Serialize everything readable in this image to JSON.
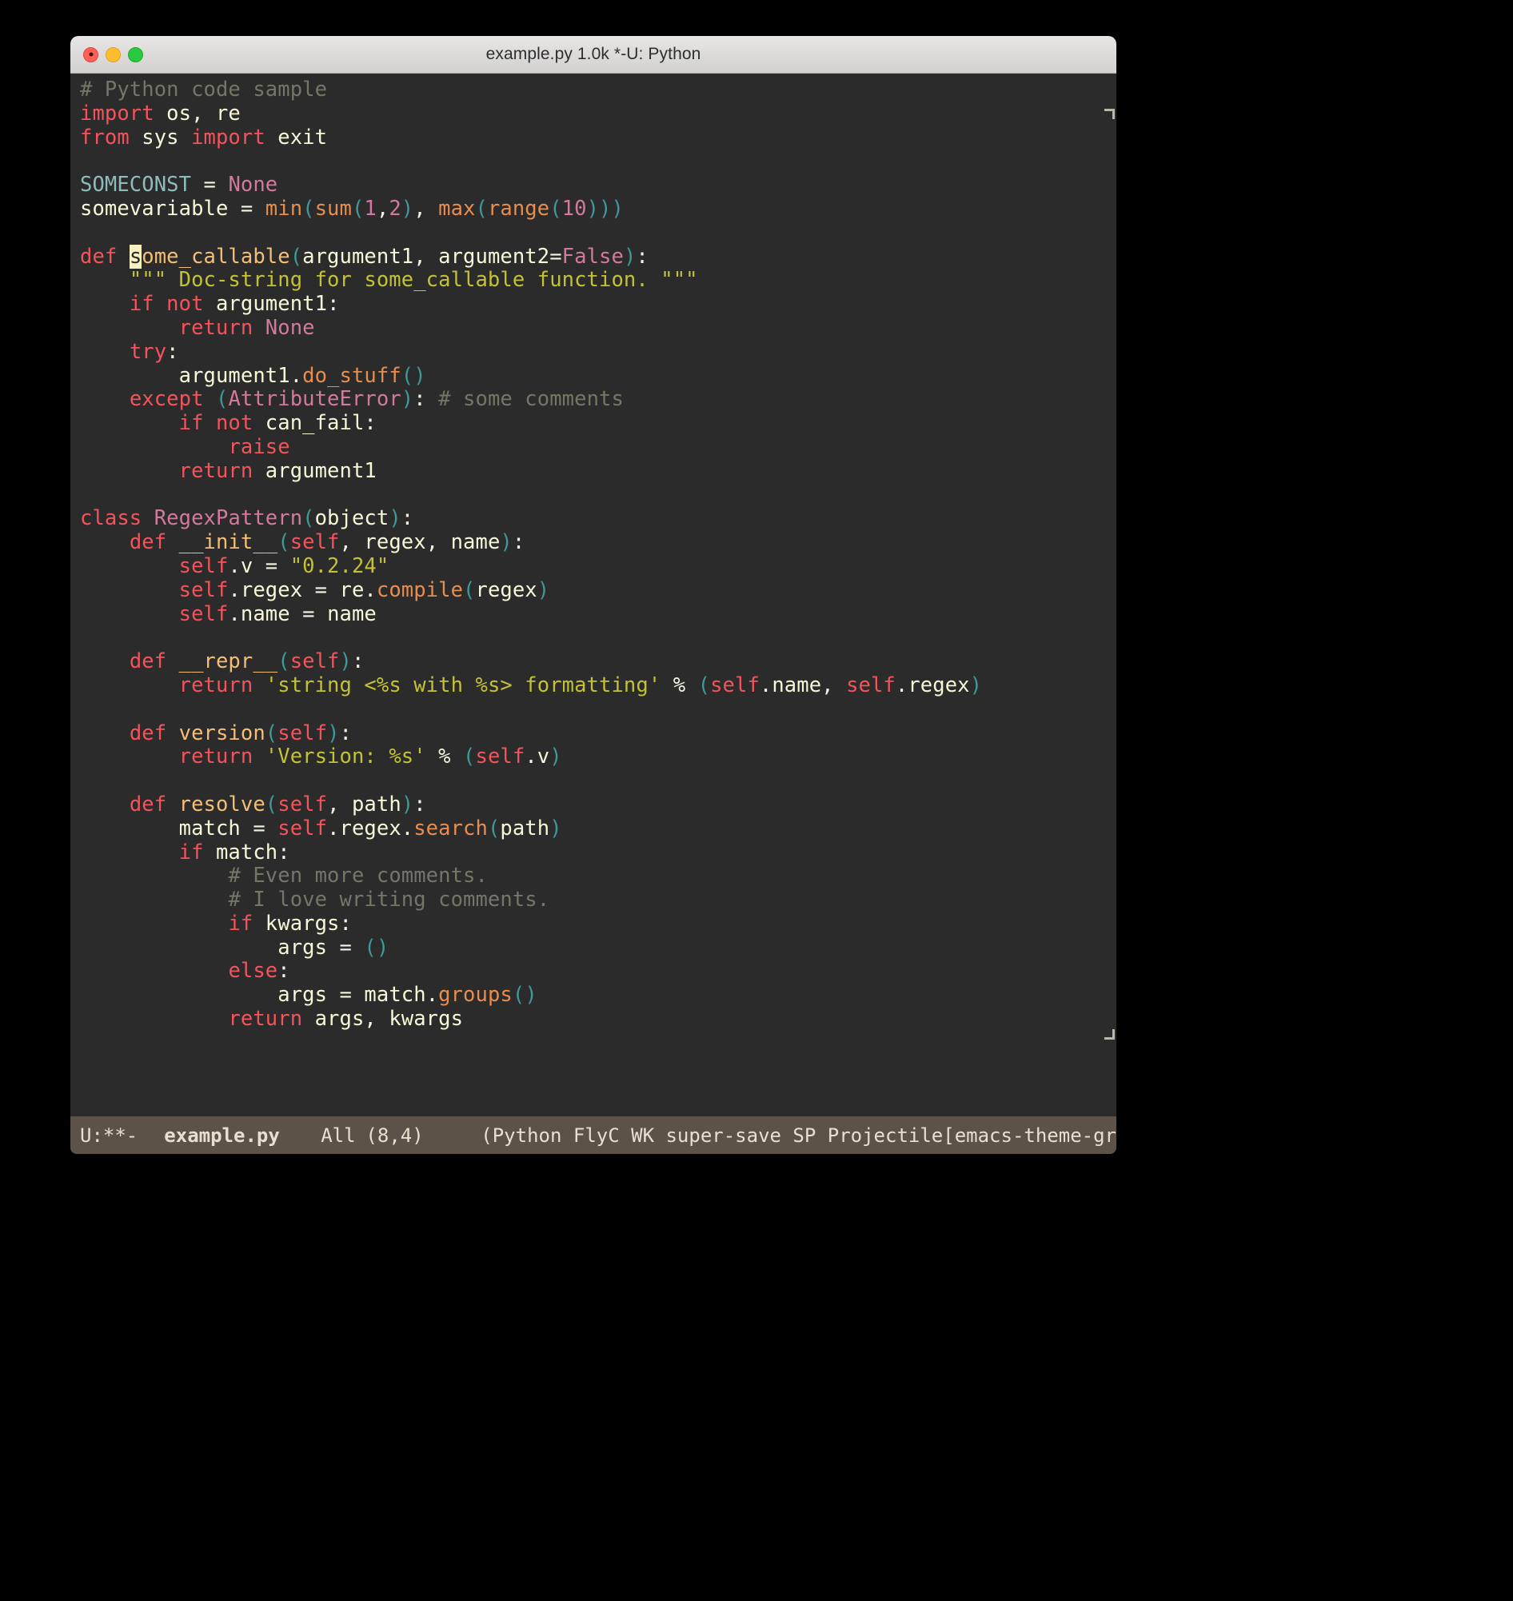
{
  "window": {
    "title": "example.py 1.0k *-U: Python",
    "traffic_lights": [
      {
        "name": "close",
        "color": "#ff5f57"
      },
      {
        "name": "minimize",
        "color": "#ffbd2e"
      },
      {
        "name": "maximize",
        "color": "#28c940"
      }
    ]
  },
  "colors": {
    "background": "#2b2b2b",
    "foreground": "#f8f8f2",
    "comment": "#757568",
    "keyword": "#f5535b",
    "builtin": "#e88d4e",
    "function": "#f4bf75",
    "string": "#c3c234",
    "constant": "#d4799e",
    "punctuation": "#3f9a97",
    "cursor": "#f8f0c0",
    "modeline_bg": "#5c5248",
    "modeline_fg": "#e8e0cf",
    "titlebar_bg": "#dcdbda"
  },
  "editor": {
    "filename": "example.py",
    "language": "Python",
    "size": "1.0k",
    "cursor_line": 8,
    "cursor_column": 4,
    "cursor_char": "s",
    "code_lines": [
      "# Python code sample",
      "import os, re",
      "from sys import exit",
      "",
      "SOMECONST = None",
      "somevariable = min(sum(1,2), max(range(10)))",
      "",
      "def some_callable(argument1, argument2=False):",
      "    \"\"\" Doc-string for some_callable function. \"\"\"",
      "    if not argument1:",
      "        return None",
      "    try:",
      "        argument1.do_stuff()",
      "    except (AttributeError): # some comments",
      "        if not can_fail:",
      "            raise",
      "        return argument1",
      "",
      "class RegexPattern(object):",
      "    def __init__(self, regex, name):",
      "        self.v = \"0.2.24\"",
      "        self.regex = re.compile(regex)",
      "        self.name = name",
      "",
      "    def __repr__(self):",
      "        return 'string <%s with %s> formatting' % (self.name, self.regex)",
      "",
      "    def version(self):",
      "        return 'Version: %s' % (self.v)",
      "",
      "    def resolve(self, path):",
      "        match = self.regex.search(path)",
      "        if match:",
      "            # Even more comments.",
      "            # I love writing comments.",
      "            if kwargs:",
      "                args = ()",
      "            else:",
      "                args = match.groups()",
      "            return args, kwargs"
    ]
  },
  "modeline": {
    "status": "U:**-",
    "buffer_name": "example.py",
    "position_scroll": "All",
    "position_point": "(8,4)",
    "minor_modes": "(Python FlyC WK super-save SP Projectile[emacs-theme-gr"
  }
}
